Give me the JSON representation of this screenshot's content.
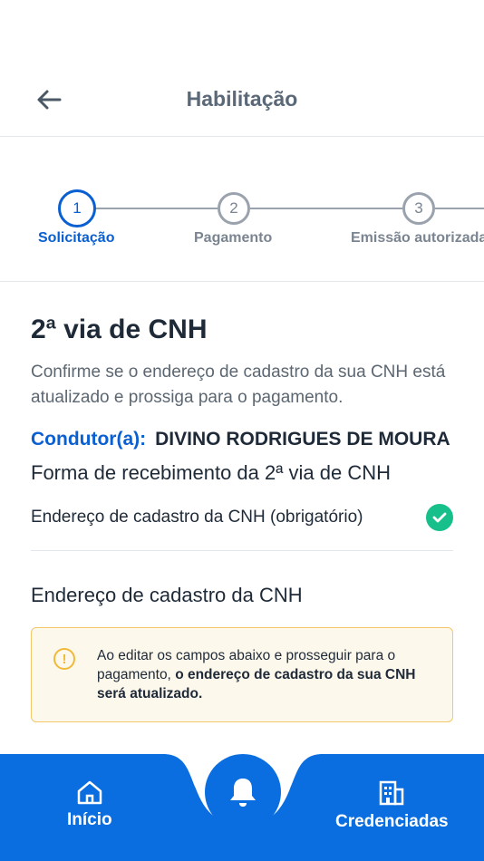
{
  "header": {
    "title": "Habilitação",
    "back_icon": "arrow-left-icon"
  },
  "stepper": {
    "steps": [
      {
        "number": "1",
        "label": "Solicitação",
        "active": true
      },
      {
        "number": "2",
        "label": "Pagamento",
        "active": false
      },
      {
        "number": "3",
        "label": "Emissão autorizada",
        "active": false
      }
    ]
  },
  "main": {
    "title": "2ª via de CNH",
    "subtitle": "Confirme se o endereço de cadastro da sua CNH está atualizado e prossiga para o pagamento.",
    "driver_label": "Condutor(a):",
    "driver_name": "DIVINO RODRIGUES DE MOURA",
    "receipt_title": "Forma de recebimento da 2ª via de CNH",
    "address_option": "Endereço de cadastro da CNH (obrigatório)",
    "section_title": "Endereço de cadastro da CNH",
    "warning_text": "Ao editar os campos abaixo e prosseguir para o pagamento,",
    "warning_bold": "o endereço de cadastro da sua CNH será atualizado."
  },
  "bottom_nav": {
    "home_label": "Início",
    "home_icon": "home-icon",
    "center_icon": "bell-icon",
    "accredited_label": "Credenciadas",
    "accredited_icon": "building-icon"
  },
  "colors": {
    "primary": "#0a6ee0",
    "success": "#17c08a",
    "warning": "#f0b93a"
  }
}
